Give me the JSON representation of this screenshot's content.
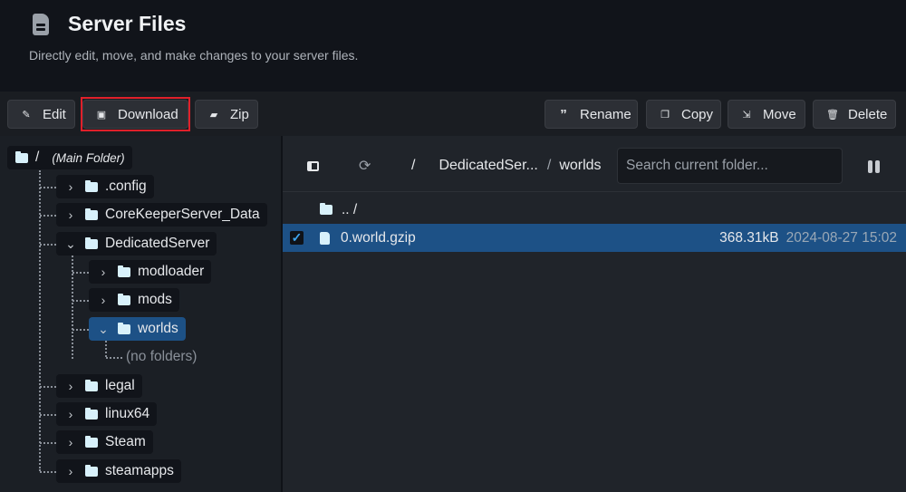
{
  "header": {
    "title": "Server Files",
    "subtitle": "Directly edit, move, and make changes to your server files."
  },
  "toolbar": {
    "edit": "Edit",
    "download": "Download",
    "zip": "Zip",
    "rename": "Rename",
    "copy": "Copy",
    "move": "Move",
    "delete": "Delete"
  },
  "tree": {
    "root": "/",
    "root_note": "(Main Folder)",
    "items": [
      ".config",
      "CoreKeeperServer_Data",
      "DedicatedServer",
      "modloader",
      "mods",
      "worlds",
      "legal",
      "linux64",
      "Steam",
      "steamapps"
    ],
    "empty": "(no folders)"
  },
  "browser": {
    "breadcrumb": [
      "/",
      "DedicatedSer...",
      "/",
      "worlds"
    ],
    "search_placeholder": "Search current folder...",
    "parent": ".. /",
    "files": [
      {
        "name": "0.world.gzip",
        "size": "368.31kB",
        "modified": "2024-08-27 15:02",
        "selected": true
      }
    ]
  },
  "colors": {
    "accent": "#1d5186",
    "highlight": "#e0202a"
  }
}
